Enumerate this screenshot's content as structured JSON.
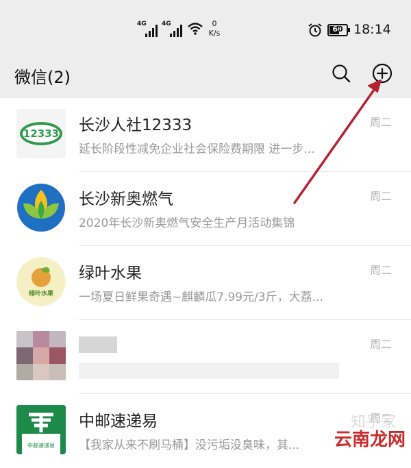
{
  "status_bar": {
    "signal1_label": "4G",
    "signal2_label": "4G",
    "speed_value": "0",
    "speed_unit": "K/s",
    "battery": "60",
    "time": "18:14"
  },
  "header": {
    "title": "微信(2)",
    "search_icon": "search-icon",
    "add_icon": "plus-circle-icon"
  },
  "chats": [
    {
      "name": "长沙人社12333",
      "preview": "延长阶段性减免企业社会保险费期限 进一步...",
      "time": "周二",
      "avatar_text": "12333"
    },
    {
      "name": "长沙新奥燃气",
      "preview": "2020年长沙新奥燃气安全生产月活动集锦",
      "time": "周二",
      "avatar_text": ""
    },
    {
      "name": "绿叶水果",
      "preview": "一场夏日鲜果奇遇~麒麟瓜7.99元/3斤，大荔...",
      "time": "周二",
      "avatar_text": "绿叶水果"
    },
    {
      "name": "",
      "preview": "",
      "time": "周二",
      "avatar_text": ""
    },
    {
      "name": "中邮速递易",
      "preview": "【我家从来不刷马桶】没污垢没臭味，其...",
      "time": "周二",
      "avatar_text": "中邮速递易"
    }
  ],
  "watermark": {
    "faint": "知乎家",
    "main": "云南龙网"
  },
  "colors": {
    "header_bg": "#ededed",
    "arrow": "#b3232f"
  }
}
